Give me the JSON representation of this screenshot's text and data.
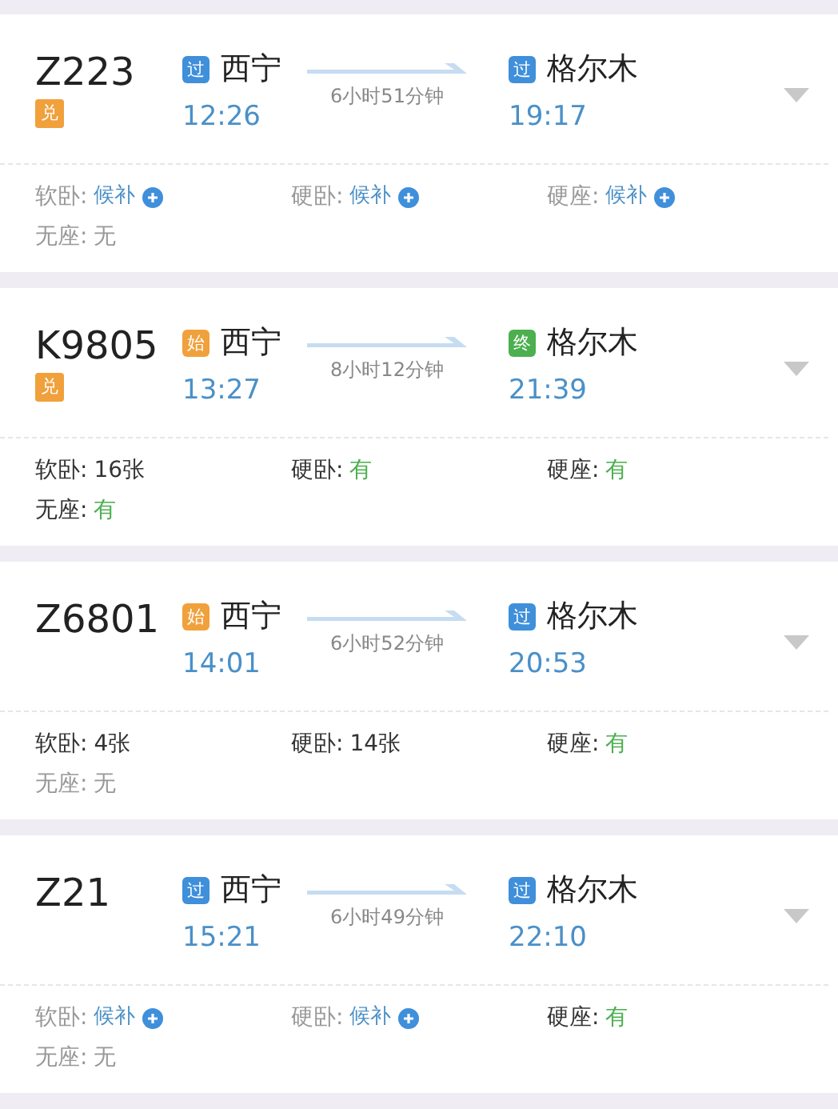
{
  "trains": [
    {
      "number": "Z223",
      "exchange_badge": "兑",
      "from": {
        "badge": "过",
        "kind": "pass",
        "station": "西宁",
        "time": "12:26"
      },
      "duration": "6小时51分钟",
      "to": {
        "badge": "过",
        "kind": "pass",
        "station": "格尔木",
        "time": "19:17"
      },
      "seats": [
        {
          "label": "软卧:",
          "value": "候补",
          "kind": "waitlist"
        },
        {
          "label": "硬卧:",
          "value": "候补",
          "kind": "waitlist"
        },
        {
          "label": "硬座:",
          "value": "候补",
          "kind": "waitlist"
        },
        {
          "label": "无座:",
          "value": "无",
          "kind": "none"
        }
      ]
    },
    {
      "number": "K9805",
      "exchange_badge": "兑",
      "from": {
        "badge": "始",
        "kind": "start",
        "station": "西宁",
        "time": "13:27"
      },
      "duration": "8小时12分钟",
      "to": {
        "badge": "终",
        "kind": "end",
        "station": "格尔木",
        "time": "21:39"
      },
      "seats": [
        {
          "label": "软卧:",
          "value": "16张",
          "kind": "count"
        },
        {
          "label": "硬卧:",
          "value": "有",
          "kind": "available"
        },
        {
          "label": "硬座:",
          "value": "有",
          "kind": "available"
        },
        {
          "label": "无座:",
          "value": "有",
          "kind": "available"
        }
      ]
    },
    {
      "number": "Z6801",
      "from": {
        "badge": "始",
        "kind": "start",
        "station": "西宁",
        "time": "14:01"
      },
      "duration": "6小时52分钟",
      "to": {
        "badge": "过",
        "kind": "pass",
        "station": "格尔木",
        "time": "20:53"
      },
      "seats": [
        {
          "label": "软卧:",
          "value": "4张",
          "kind": "count"
        },
        {
          "label": "硬卧:",
          "value": "14张",
          "kind": "count"
        },
        {
          "label": "硬座:",
          "value": "有",
          "kind": "available"
        },
        {
          "label": "无座:",
          "value": "无",
          "kind": "none"
        }
      ]
    },
    {
      "number": "Z21",
      "from": {
        "badge": "过",
        "kind": "pass",
        "station": "西宁",
        "time": "15:21"
      },
      "duration": "6小时49分钟",
      "to": {
        "badge": "过",
        "kind": "pass",
        "station": "格尔木",
        "time": "22:10"
      },
      "seats": [
        {
          "label": "软卧:",
          "value": "候补",
          "kind": "waitlist"
        },
        {
          "label": "硬卧:",
          "value": "候补",
          "kind": "waitlist"
        },
        {
          "label": "硬座:",
          "value": "有",
          "kind": "available"
        },
        {
          "label": "无座:",
          "value": "无",
          "kind": "none"
        }
      ]
    }
  ]
}
